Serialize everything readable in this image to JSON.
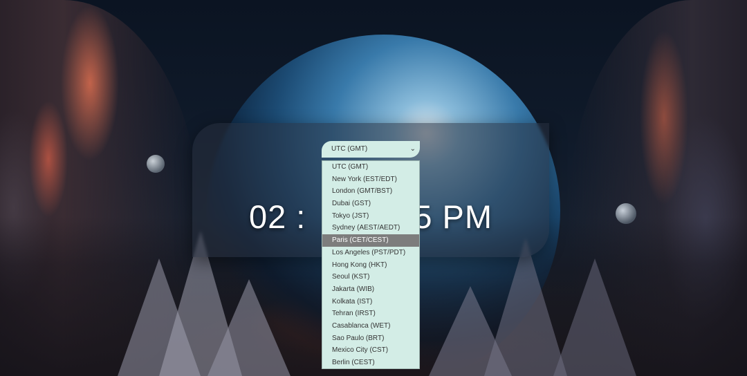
{
  "clock": {
    "time_left": "02 :",
    "time_right": "5 PM"
  },
  "timezone_select": {
    "value": "UTC (GMT)",
    "chevron": "chevron-down-icon",
    "options": [
      "UTC (GMT)",
      "New York (EST/EDT)",
      "London (GMT/BST)",
      "Dubai (GST)",
      "Tokyo (JST)",
      "Sydney (AEST/AEDT)",
      "Paris (CET/CEST)",
      "Los Angeles (PST/PDT)",
      "Hong Kong (HKT)",
      "Seoul (KST)",
      "Jakarta (WIB)",
      "Kolkata (IST)",
      "Tehran (IRST)",
      "Casablanca (WET)",
      "Sao Paulo (BRT)",
      "Mexico City (CST)",
      "Berlin (CEST)"
    ],
    "highlighted_index": 6
  },
  "colors": {
    "select_bg": "#d3ede6",
    "highlight_bg": "#7d7d7d",
    "card_bg": "rgba(40,48,62,0.55)"
  }
}
